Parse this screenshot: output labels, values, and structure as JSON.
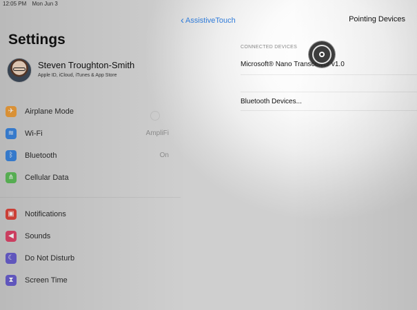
{
  "status_bar": {
    "time": "12:05 PM",
    "date": "Mon Jun 3"
  },
  "sidebar": {
    "title": "Settings",
    "profile": {
      "name": "Steven Troughton-Smith",
      "subtitle": "Apple ID, iCloud, iTunes & App Store"
    },
    "items": [
      {
        "label": "Airplane Mode",
        "value": "",
        "icon": "airplane-icon",
        "color": "#f0a03c"
      },
      {
        "label": "Wi-Fi",
        "value": "AmpliFi",
        "icon": "wifi-icon",
        "color": "#3b86e0"
      },
      {
        "label": "Bluetooth",
        "value": "On",
        "icon": "bluetooth-icon",
        "color": "#3b86e0"
      },
      {
        "label": "Cellular Data",
        "value": "",
        "icon": "antenna-icon",
        "color": "#5fbf5a"
      },
      {
        "label": "Notifications",
        "value": "",
        "icon": "notifications-icon",
        "color": "#e0453b"
      },
      {
        "label": "Sounds",
        "value": "",
        "icon": "speaker-icon",
        "color": "#e0456a"
      },
      {
        "label": "Do Not Disturb",
        "value": "",
        "icon": "moon-icon",
        "color": "#6a5fd0"
      },
      {
        "label": "Screen Time",
        "value": "",
        "icon": "hourglass-icon",
        "color": "#6a5fd0"
      }
    ]
  },
  "detail": {
    "back_label": "AssistiveTouch",
    "title": "Pointing Devices",
    "section_header": "CONNECTED DEVICES",
    "connected_device": "Microsoft® Nano Transceiver v1.0",
    "bluetooth_label": "Bluetooth Devices..."
  },
  "colors": {
    "accent": "#2f7bd9"
  }
}
